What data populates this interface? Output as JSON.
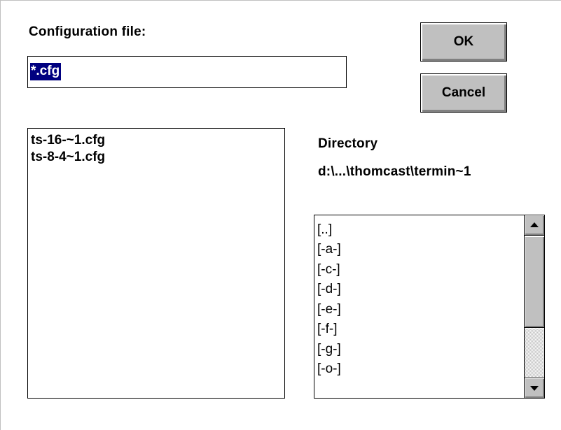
{
  "dialog": {
    "config_label": "Configuration file:",
    "filename_value": "*.cfg",
    "ok_label": "OK",
    "cancel_label": "Cancel",
    "directory_label": "Directory",
    "directory_path": "d:\\...\\thomcast\\termin~1"
  },
  "files": [
    "ts-16-~1.cfg",
    "ts-8-4~1.cfg"
  ],
  "directories": [
    "[..]",
    "[-a-]",
    "[-c-]",
    "[-d-]",
    "[-e-]",
    "[-f-]",
    "[-g-]",
    "[-o-]"
  ],
  "colors": {
    "selection": "#000080",
    "button_face": "#c0c0c0"
  }
}
